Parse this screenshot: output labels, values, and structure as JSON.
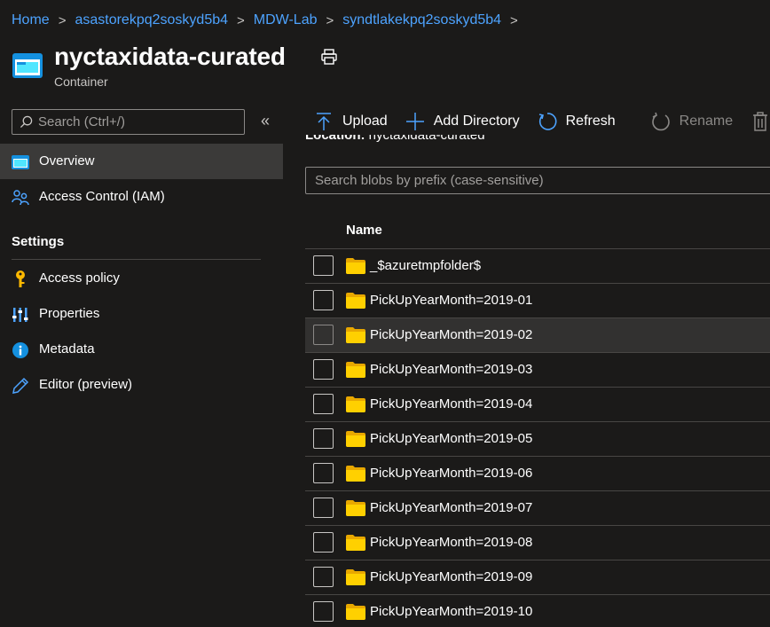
{
  "breadcrumb": {
    "items": [
      "Home",
      "asastorekpq2soskyd5b4",
      "MDW-Lab",
      "syndtlakekpq2soskyd5b4"
    ],
    "separator": ">"
  },
  "header": {
    "title": "nyctaxidata-curated",
    "subtitle": "Container",
    "icon": "storage-container-icon",
    "print_icon": "print-icon"
  },
  "sidebar": {
    "search_placeholder": "Search (Ctrl+/)",
    "collapse_glyph": "«",
    "items": [
      {
        "label": "Overview",
        "icon": "overview-icon",
        "active": true
      },
      {
        "label": "Access Control (IAM)",
        "icon": "people-icon",
        "active": false
      }
    ],
    "settings_header": "Settings",
    "settings_items": [
      {
        "label": "Access policy",
        "icon": "key-icon"
      },
      {
        "label": "Properties",
        "icon": "properties-icon"
      },
      {
        "label": "Metadata",
        "icon": "info-icon"
      },
      {
        "label": "Editor (preview)",
        "icon": "pencil-icon"
      }
    ]
  },
  "toolbar": {
    "upload_label": "Upload",
    "add_directory_label": "Add Directory",
    "refresh_label": "Refresh",
    "rename_label": "Rename"
  },
  "main": {
    "location_label": "Location:",
    "location_value": "nyctaxidata-curated",
    "blob_search_placeholder": "Search blobs by prefix (case-sensitive)",
    "column_name": "Name",
    "rows": [
      "_$azuretmpfolder$",
      "PickUpYearMonth=2019-01",
      "PickUpYearMonth=2019-02",
      "PickUpYearMonth=2019-03",
      "PickUpYearMonth=2019-04",
      "PickUpYearMonth=2019-05",
      "PickUpYearMonth=2019-06",
      "PickUpYearMonth=2019-07",
      "PickUpYearMonth=2019-08",
      "PickUpYearMonth=2019-09",
      "PickUpYearMonth=2019-10"
    ],
    "hovered_row_index": 2
  },
  "colors": {
    "background": "#1b1a19",
    "link": "#4da3ff",
    "accent": "#0078d4",
    "folder": "#ffd000",
    "active_nav": "#3b3a39"
  }
}
